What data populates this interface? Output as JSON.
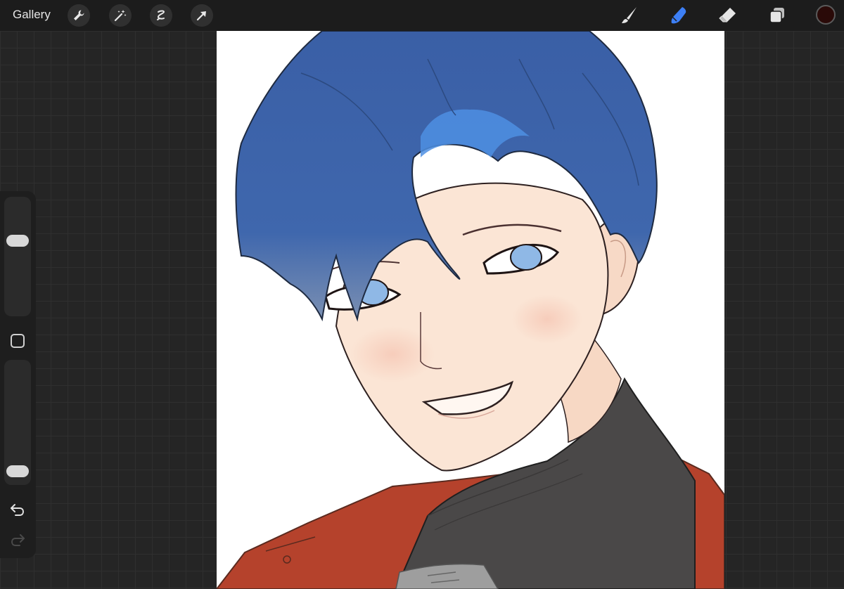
{
  "toolbar": {
    "gallery_label": "Gallery",
    "left_tools": [
      "wrench-icon",
      "magic-wand-icon",
      "selection-icon",
      "transform-arrow-icon"
    ],
    "right_tools": [
      "brush-icon",
      "smudge-icon",
      "eraser-icon",
      "layers-icon"
    ],
    "active_tool": "smudge-icon",
    "accent_color": "#3d7ff5",
    "current_color": "#2a0a08"
  },
  "sidebar": {
    "brush_size_level": 0.35,
    "opacity_level": 0.93,
    "tools": [
      "modify-square-icon",
      "undo-icon",
      "redo-icon"
    ]
  },
  "canvas": {
    "background": "#ffffff",
    "hair_color": "#3b63a8",
    "skin_color": "#fbe5d5",
    "eye_color": "#8fb8e6",
    "sweater_color": "#4a4848",
    "jacket_color": "#b5422c"
  }
}
